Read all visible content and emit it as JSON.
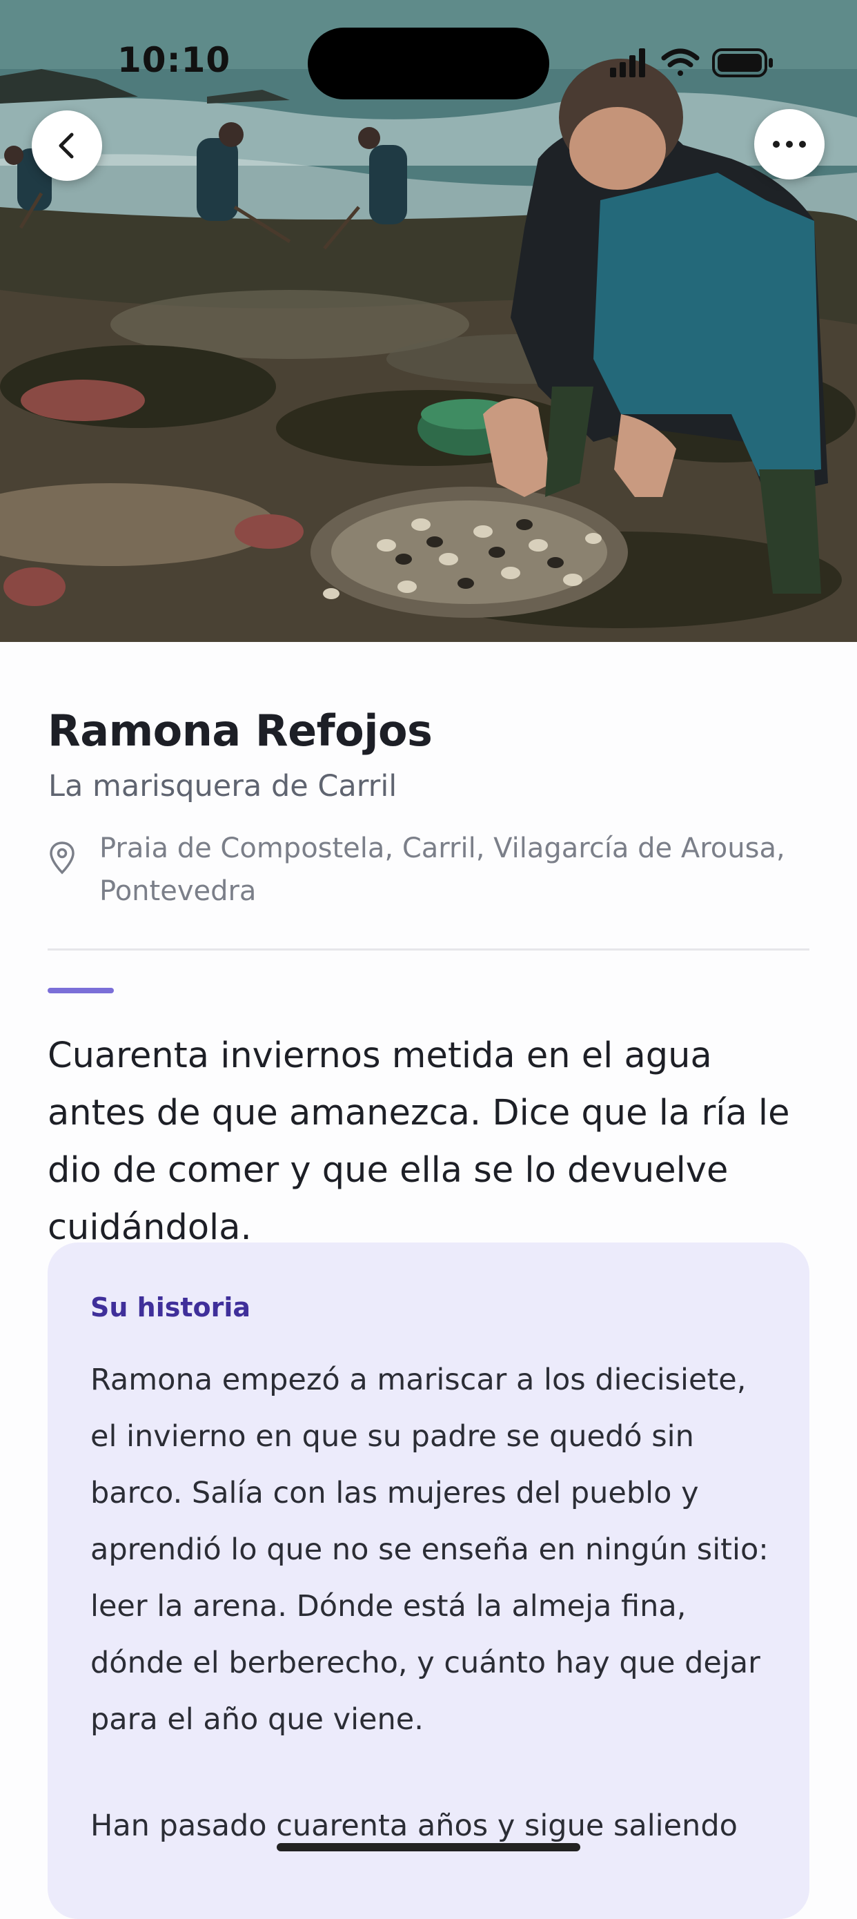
{
  "status_bar": {
    "time": "10:10",
    "icons": [
      "signal-icon",
      "wifi-icon",
      "battery-icon"
    ]
  },
  "hero": {
    "image": "photo of shellfish gatherers on a rocky, seaweed-covered beach at low tide"
  },
  "nav": {
    "back_icon": "chevron-left-icon",
    "more_icon": "more-horizontal-icon"
  },
  "profile": {
    "name": "Ramona Refojos",
    "subtitle": "La marisquera de Carril",
    "location": "Praia de Compostela, Carril, Vilagarcía de Arousa, Pontevedra"
  },
  "quote": "Cuarenta inviernos metida en el agua antes de que amanezca. Dice que la ría le dio de comer y que ella se lo devuelve cuidándola.",
  "story": {
    "label": "Su historia",
    "paragraphs": [
      "Ramona empezó a mariscar a los diecisiete, el invierno en que su padre se quedó sin barco. Salía con las mujeres del pueblo y aprendió lo que no se enseña en ningún sitio: leer la arena. Dónde está la almeja fina, dónde el berberecho, y cuánto hay que dejar para el año que viene.",
      "Han pasado cuarenta años y sigue saliendo"
    ]
  },
  "colors": {
    "accent": "#7b6fd8",
    "card_background": "#ecebfb",
    "card_label": "#3f2f9a",
    "text_primary": "#1d1f26",
    "text_secondary": "#5f6470"
  }
}
